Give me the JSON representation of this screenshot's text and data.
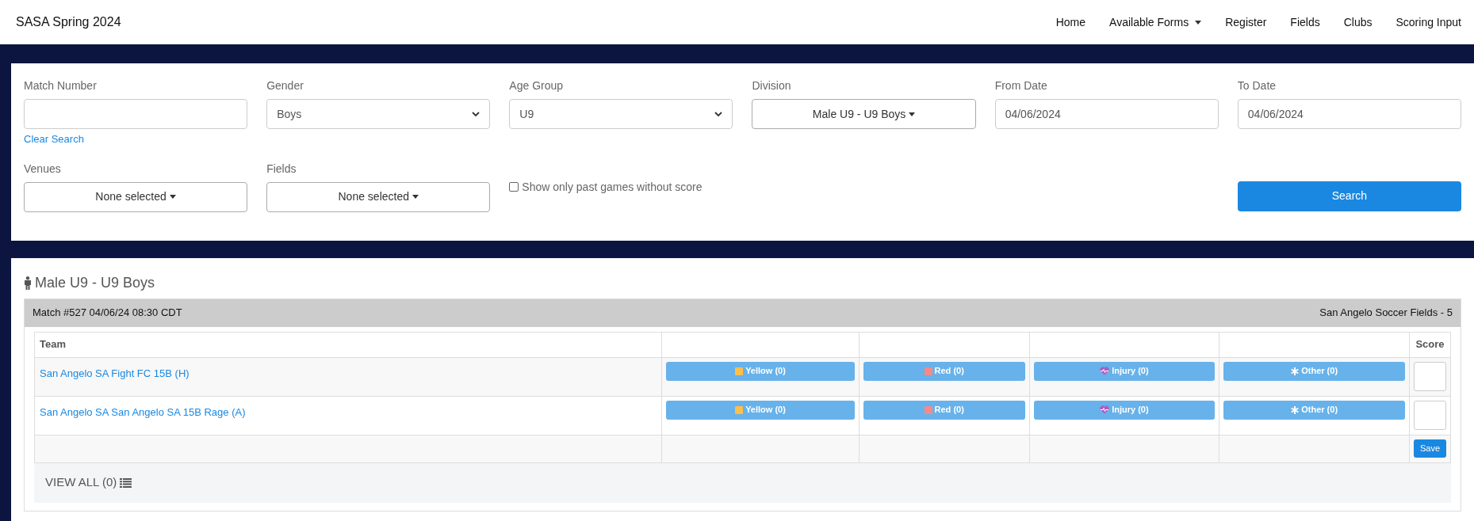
{
  "brand": "SASA Spring 2024",
  "nav": [
    {
      "label": "Home",
      "dropdown": false
    },
    {
      "label": "Available Forms",
      "dropdown": true
    },
    {
      "label": "Register",
      "dropdown": false
    },
    {
      "label": "Fields",
      "dropdown": false
    },
    {
      "label": "Clubs",
      "dropdown": false
    },
    {
      "label": "Scoring Input",
      "dropdown": false
    }
  ],
  "filters": {
    "match_number": {
      "label": "Match Number"
    },
    "clear_search": "Clear Search",
    "gender": {
      "label": "Gender",
      "value": "Boys"
    },
    "age_group": {
      "label": "Age Group",
      "value": "U9"
    },
    "division": {
      "label": "Division",
      "value": "Male U9 - U9 Boys"
    },
    "from_date": {
      "label": "From Date",
      "value": "04/06/2024"
    },
    "to_date": {
      "label": "To Date",
      "value": "04/06/2024"
    },
    "venues": {
      "label": "Venues",
      "value": "None selected"
    },
    "fields": {
      "label": "Fields",
      "value": "None selected"
    },
    "past_games": {
      "label": "Show only past games without score",
      "checked": false
    },
    "search_button": "Search"
  },
  "division_title": "Male U9 - U9 Boys",
  "match": {
    "header": "Match #527 04/06/24 08:30 CDT",
    "venue": "San Angelo Soccer Fields - 5",
    "columns": [
      "Team",
      "Score"
    ],
    "rows": [
      {
        "team": "San Angelo SA Fight FC 15B (H)",
        "events": [
          {
            "kind": "yellow",
            "label": "Yellow (0)"
          },
          {
            "kind": "red",
            "label": "Red (0)"
          },
          {
            "kind": "injury",
            "label": "Injury (0)"
          },
          {
            "kind": "other",
            "label": "Other (0)"
          }
        ]
      },
      {
        "team": "San Angelo SA San Angelo SA 15B Rage (A)",
        "events": [
          {
            "kind": "yellow",
            "label": "Yellow (0)"
          },
          {
            "kind": "red",
            "label": "Red (0)"
          },
          {
            "kind": "injury",
            "label": "Injury (0)"
          },
          {
            "kind": "other",
            "label": "Other (0)"
          }
        ]
      }
    ],
    "save_button": "Save",
    "view_all": "VIEW ALL (0)"
  }
}
